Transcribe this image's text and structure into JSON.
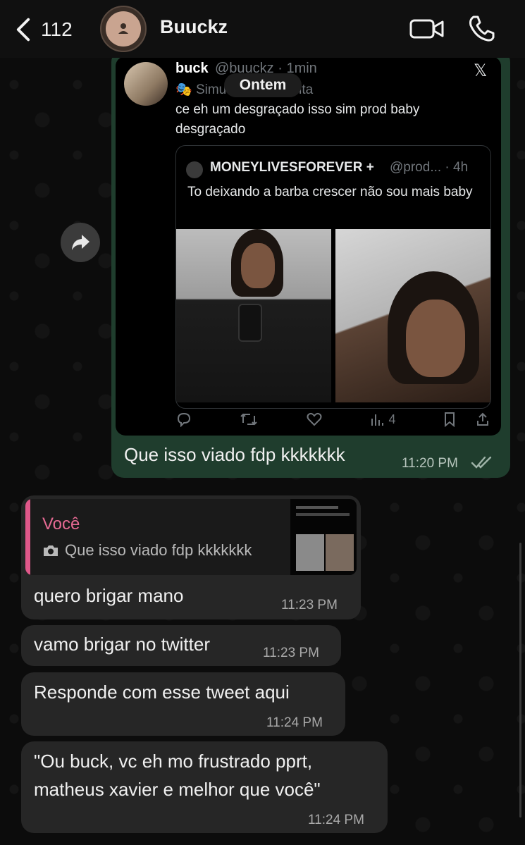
{
  "header": {
    "back_count": "112",
    "contact_name": "Buuckz",
    "icons": [
      "chevron-left-icon",
      "person-icon",
      "video-camera-icon",
      "phone-icon"
    ]
  },
  "date_chip": "Ontem",
  "tweet": {
    "name": "buck",
    "handle": "@buuckz · 1min",
    "community": "Simu",
    "community_tail": "onta",
    "text": "ce eh um desgraçado isso sim prod baby desgraçado",
    "quote": {
      "name": "MONEYLIVESFOREVER +",
      "handle": "@prod... · 4h",
      "text": "To deixando a barba crescer não sou mais baby"
    },
    "views": "4"
  },
  "outgoing": {
    "text": "Que isso viado fdp kkkkkkk",
    "time": "11:20 PM"
  },
  "reply": {
    "name": "Você",
    "text": "Que isso viado fdp kkkkkkk"
  },
  "incoming": [
    {
      "text": "quero brigar mano",
      "time": "11:23 PM"
    },
    {
      "text": "vamo brigar no twitter",
      "time": "11:23 PM"
    },
    {
      "text": "Responde com esse tweet aqui",
      "time": "11:24 PM"
    },
    {
      "line1": "\"Ou buck, vc eh mo frustrado pprt,",
      "line2": "matheus xavier e melhor que você\"",
      "time": "11:24 PM"
    }
  ],
  "colors": {
    "outgoing_bubble": "#1f3d2d",
    "incoming_bubble": "#262626",
    "reply_accent": "#e0588a"
  }
}
